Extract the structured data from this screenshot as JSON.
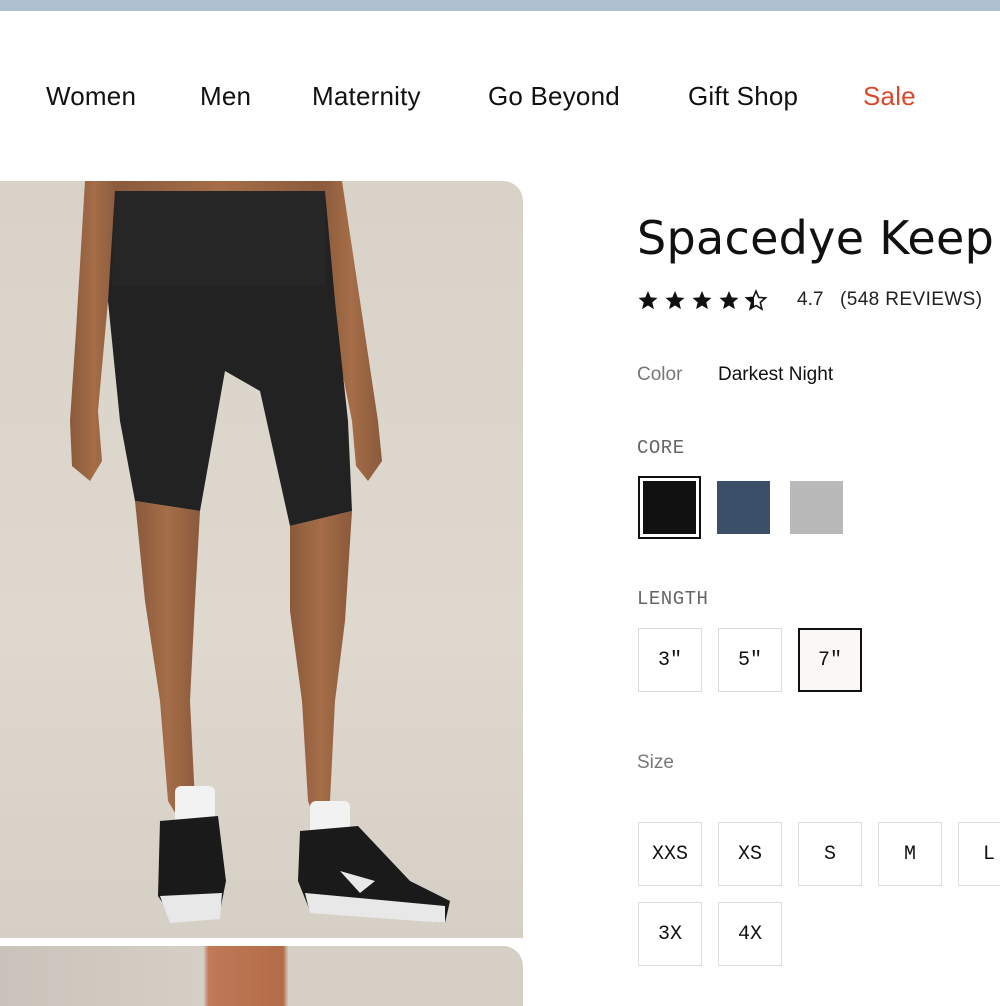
{
  "nav": {
    "items": [
      "Women",
      "Men",
      "Maternity",
      "Go Beyond",
      "Gift Shop"
    ],
    "sale": "Sale"
  },
  "product": {
    "title": "Spacedye Keep",
    "rating": "4.7",
    "rating_stars": 4.7,
    "reviews": "(548 REVIEWS)",
    "color_label": "Color",
    "color_value": "Darkest Night",
    "core_label": "CORE",
    "swatches": [
      {
        "name": "darkest-night",
        "color": "#111111",
        "selected": true
      },
      {
        "name": "navy",
        "color": "#3b5068",
        "selected": false
      },
      {
        "name": "heather-grey",
        "color": "#b9b9b9",
        "selected": false
      }
    ],
    "length_label": "LENGTH",
    "lengths": [
      "3\"",
      "5\"",
      "7\""
    ],
    "selected_length": "7\"",
    "size_label": "Size",
    "sizes_row1": [
      "XXS",
      "XS",
      "S",
      "M",
      "L"
    ],
    "sizes_row2": [
      "3X",
      "4X"
    ]
  },
  "colors": {
    "sale": "#d84a2b",
    "top_strip": "#aebfd0"
  }
}
